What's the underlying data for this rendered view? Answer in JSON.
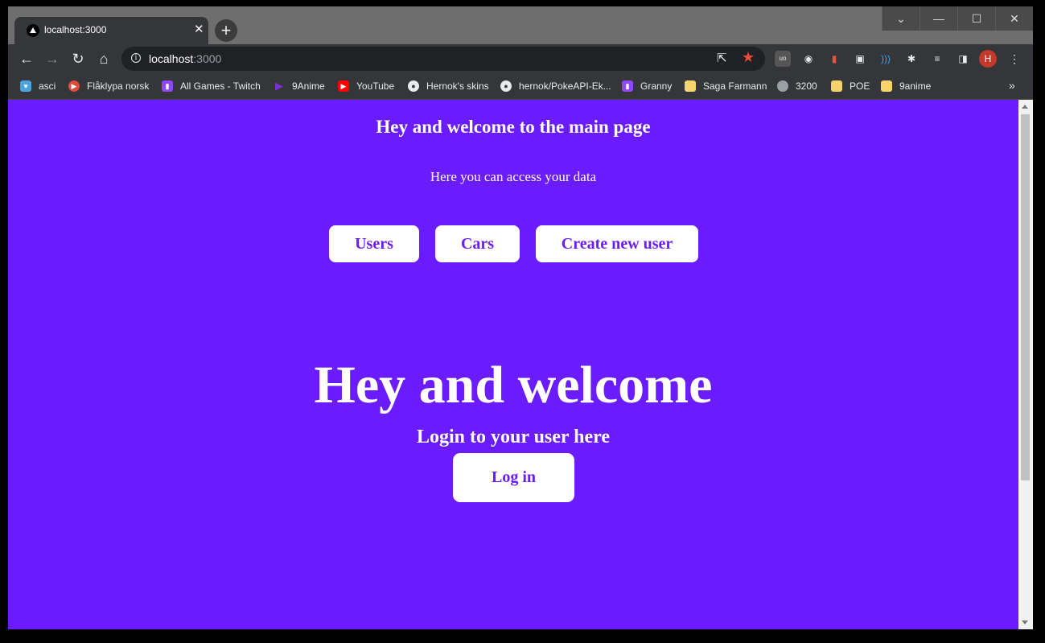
{
  "browser": {
    "tab": {
      "title": "localhost:3000",
      "favicon": "nextjs-triangle-icon"
    },
    "window_controls": [
      "chevron-down-icon",
      "minimize-icon",
      "maximize-icon",
      "close-icon"
    ],
    "address": {
      "host": "localhost",
      "port": ":3000"
    },
    "profile_initial": "H",
    "bookmarks": [
      {
        "label": "asci",
        "icon": "heart-icon",
        "color": "#4aa3df"
      },
      {
        "label": "Flåklypa norsk",
        "icon": "play-circle-icon",
        "color": "#e04a3a"
      },
      {
        "label": "All Games - Twitch",
        "icon": "twitch-icon",
        "color": "#9146ff"
      },
      {
        "label": "9Anime",
        "icon": "play-triangle-icon",
        "color": "#7b2fd6"
      },
      {
        "label": "YouTube",
        "icon": "youtube-icon",
        "color": "#ff0000"
      },
      {
        "label": "Hernok's skins",
        "icon": "github-icon",
        "color": "#e8eaed"
      },
      {
        "label": "hernok/PokeAPI-Ek...",
        "icon": "github-icon",
        "color": "#e8eaed"
      },
      {
        "label": "Granny",
        "icon": "twitch-icon",
        "color": "#9146ff"
      },
      {
        "label": "Saga Farmann",
        "icon": "folder-icon",
        "color": "#f6d36b"
      },
      {
        "label": "3200",
        "icon": "globe-icon",
        "color": "#9aa0a6"
      },
      {
        "label": "POE",
        "icon": "folder-icon",
        "color": "#f6d36b"
      },
      {
        "label": "9anime",
        "icon": "folder-icon",
        "color": "#f6d36b"
      }
    ]
  },
  "page": {
    "background": "#6b1cff",
    "title": "Hey and welcome to the main page",
    "subtitle": "Here you can access your data",
    "buttons": [
      {
        "label": "Users"
      },
      {
        "label": "Cars"
      },
      {
        "label": "Create new user"
      }
    ],
    "hero": "Hey and welcome",
    "login_caption": "Login to your user here",
    "login_button": "Log in"
  }
}
